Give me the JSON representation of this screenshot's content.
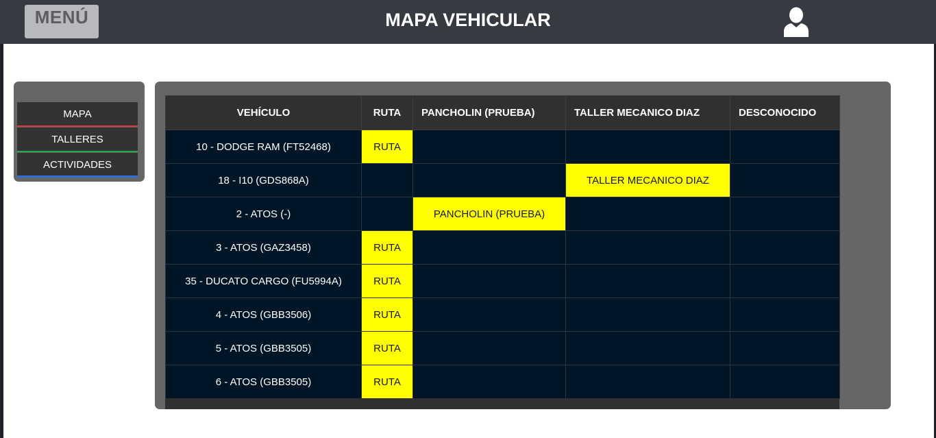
{
  "header": {
    "menu_label": "MENÚ",
    "title": "MAPA VEHICULAR",
    "user_icon": "user-icon"
  },
  "sidebar": {
    "items": [
      {
        "label": "MAPA",
        "accent": "#dc3545"
      },
      {
        "label": "TALLERES",
        "accent": "#28a745"
      },
      {
        "label": "ACTIVIDADES",
        "accent": "#2f6fd6"
      }
    ]
  },
  "table": {
    "columns": [
      "VEHÍCULO",
      "RUTA",
      "PANCHOLIN (PRUEBA)",
      "TALLER MECANICO DIAZ",
      "DESCONOCIDO"
    ],
    "highlight_color": "#ffff00",
    "rows": [
      {
        "vehicle": "10 - DODGE RAM (FT52468)",
        "cells": [
          "RUTA",
          "",
          "",
          ""
        ]
      },
      {
        "vehicle": "18 - I10 (GDS868A)",
        "cells": [
          "",
          "",
          "TALLER MECANICO DIAZ",
          ""
        ]
      },
      {
        "vehicle": "2 - ATOS (-)",
        "cells": [
          "",
          "PANCHOLIN (PRUEBA)",
          "",
          ""
        ]
      },
      {
        "vehicle": "3 - ATOS (GAZ3458)",
        "cells": [
          "RUTA",
          "",
          "",
          ""
        ]
      },
      {
        "vehicle": "35 - DUCATO CARGO (FU5994A)",
        "cells": [
          "RUTA",
          "",
          "",
          ""
        ]
      },
      {
        "vehicle": "4 - ATOS (GBB3506)",
        "cells": [
          "RUTA",
          "",
          "",
          ""
        ]
      },
      {
        "vehicle": "5 - ATOS (GBB3505)",
        "cells": [
          "RUTA",
          "",
          "",
          ""
        ]
      },
      {
        "vehicle": "6 - ATOS (GBB3505)",
        "cells": [
          "RUTA",
          "",
          "",
          ""
        ]
      }
    ]
  }
}
